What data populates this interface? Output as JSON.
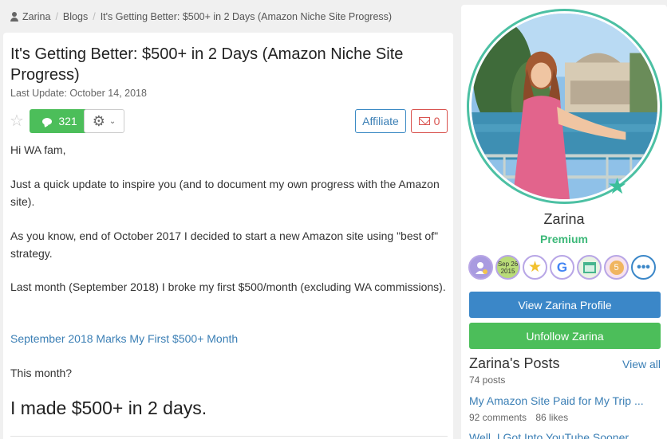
{
  "breadcrumb": {
    "user": "Zarina",
    "section": "Blogs",
    "current": "It's Getting Better: $500+ in 2 Days (Amazon Niche Site Progress)"
  },
  "post": {
    "title": "It's Getting Better: $500+ in 2 Days (Amazon Niche Site Progress)",
    "last_update": "Last Update: October 14, 2018",
    "comments_count": "321",
    "affiliate_label": "Affiliate",
    "mail_count": "0",
    "paragraphs": [
      "Hi WA fam,",
      "Just a quick update to inspire you (and to document my own progress with the Amazon site).",
      "As you know, end of October 2017 I decided to start a new Amazon site using \"best of\" strategy.",
      "Last month (September 2018) I broke my first $500/month (excluding WA commissions)."
    ],
    "link_text": "September 2018 Marks My First $500+ Month",
    "this_month": "This month?",
    "big_line": "I made $500+ in 2 days."
  },
  "profile": {
    "name": "Zarina",
    "membership": "Premium",
    "badges": [
      "ambassador-badge",
      "Sep 26 2015",
      "star-badge",
      "G",
      "website-badge",
      "5"
    ],
    "view_profile_label": "View Zarina Profile",
    "unfollow_label": "Unfollow Zarina",
    "posts_title": "Zarina's Posts",
    "view_all_label": "View all",
    "posts_count": "74 posts",
    "recent_post": {
      "title": "My Amazon Site Paid for My Trip ...",
      "comments": "92 comments",
      "likes": "86 likes"
    },
    "next_post_title": "Well, I Got Into YouTube Sooner ..."
  },
  "colors": {
    "accent_blue": "#3b87c8",
    "accent_green": "#4cbe5a",
    "premium_green": "#3cb878",
    "mail_red": "#d9534f",
    "ring_teal": "#4cc0a3"
  }
}
